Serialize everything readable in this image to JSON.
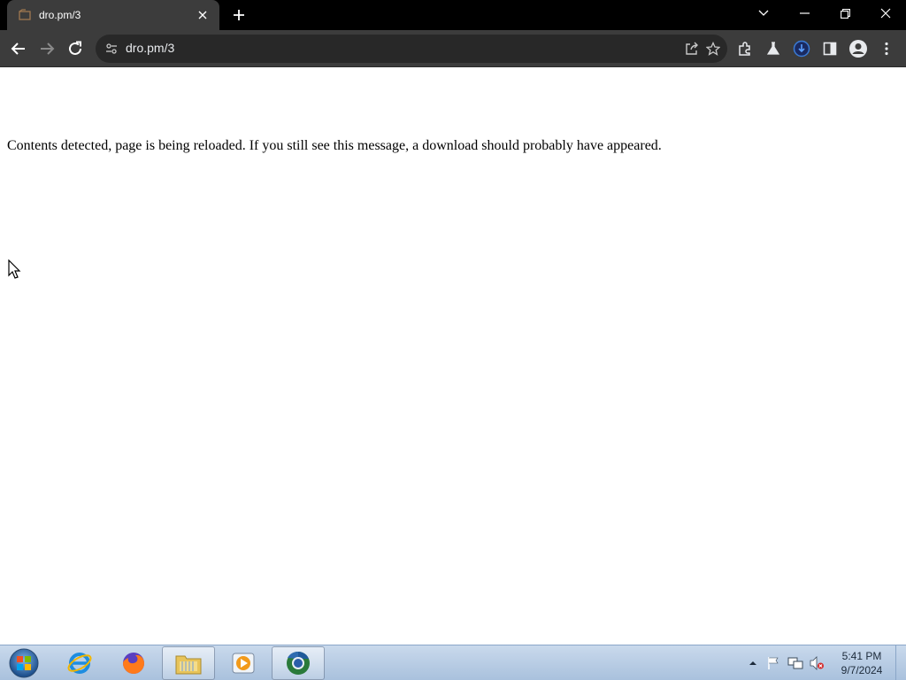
{
  "browser": {
    "tab": {
      "title": "dro.pm/3"
    },
    "address_bar": {
      "url": "dro.pm/3"
    }
  },
  "page": {
    "message": "Contents detected, page is being reloaded. If you still see this message, a download should probably have appeared."
  },
  "taskbar": {
    "apps": [
      "Internet Explorer",
      "Firefox",
      "Windows Explorer",
      "Windows Media Player",
      "Google Chrome"
    ],
    "clock": {
      "time": "5:41 PM",
      "date": "9/7/2024"
    }
  }
}
